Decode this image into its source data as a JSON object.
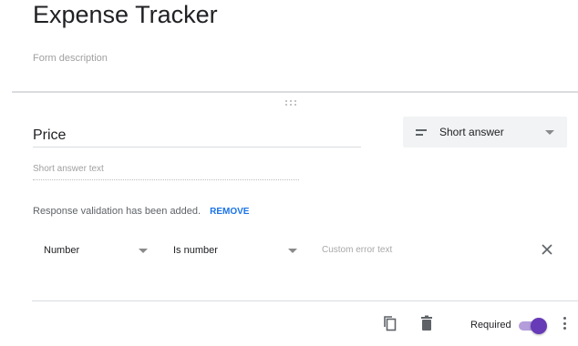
{
  "form": {
    "title": "Expense Tracker",
    "description_placeholder": "Form description"
  },
  "question": {
    "title": "Price",
    "type": "Short answer",
    "answer_placeholder": "Short answer text",
    "validation": {
      "message": "Response validation has been added.",
      "remove_label": "REMOVE",
      "rule_type": "Number",
      "condition": "Is number",
      "error_placeholder": "Custom error text"
    },
    "required_label": "Required",
    "required": true
  },
  "icons": {
    "drag": "drag-handle-icon",
    "type": "short-answer-lines-icon",
    "close": "close-icon",
    "duplicate": "copy-icon",
    "delete": "trash-icon",
    "more": "more-vert-icon"
  },
  "colors": {
    "accent": "#673ab7",
    "link": "#1a73e8"
  }
}
